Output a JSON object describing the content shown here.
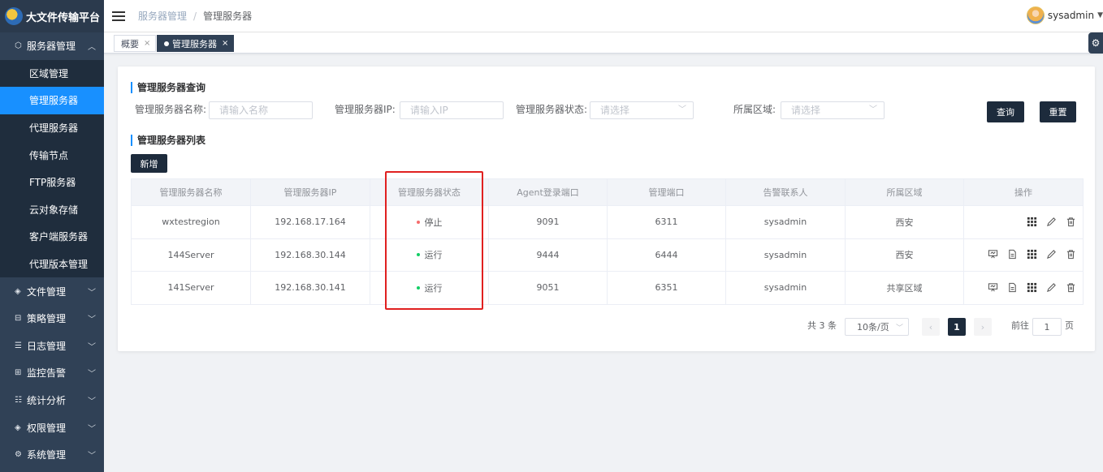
{
  "app": {
    "title": "大文件传输平台"
  },
  "sidebar": {
    "groups": [
      {
        "label": "服务器管理",
        "icon": "cube-icon",
        "expanded": true,
        "items": [
          "区域管理",
          "管理服务器",
          "代理服务器",
          "传输节点",
          "FTP服务器",
          "云对象存储",
          "客户端服务器",
          "代理版本管理"
        ],
        "active": "管理服务器"
      },
      {
        "label": "文件管理",
        "icon": "layers-icon"
      },
      {
        "label": "策略管理",
        "icon": "policy-icon"
      },
      {
        "label": "日志管理",
        "icon": "log-icon"
      },
      {
        "label": "监控告警",
        "icon": "monitor-icon"
      },
      {
        "label": "统计分析",
        "icon": "stats-icon"
      },
      {
        "label": "权限管理",
        "icon": "permission-icon"
      },
      {
        "label": "系统管理",
        "icon": "settings-icon"
      }
    ]
  },
  "header": {
    "breadcrumb": [
      "服务器管理",
      "管理服务器"
    ],
    "username": "sysadmin"
  },
  "tags": [
    {
      "label": "概要",
      "active": false
    },
    {
      "label": "管理服务器",
      "active": true
    }
  ],
  "query": {
    "title": "管理服务器查询",
    "name_label": "管理服务器名称:",
    "name_placeholder": "请输入名称",
    "ip_label": "管理服务器IP:",
    "ip_placeholder": "请输入IP",
    "status_label": "管理服务器状态:",
    "status_placeholder": "请选择",
    "region_label": "所属区域:",
    "region_placeholder": "请选择",
    "search_btn": "查询",
    "reset_btn": "重置"
  },
  "list": {
    "title": "管理服务器列表",
    "add_btn": "新增",
    "columns": [
      "管理服务器名称",
      "管理服务器IP",
      "管理服务器状态",
      "Agent登录端口",
      "管理端口",
      "告警联系人",
      "所属区域",
      "操作"
    ],
    "rows": [
      {
        "name": "wxtestregion",
        "ip": "192.168.17.164",
        "status": "停止",
        "status_color": "#f56c6c",
        "agent_port": "9091",
        "mgmt_port": "6311",
        "contact": "sysadmin",
        "region": "西安",
        "ops": [
          "grid-icon",
          "edit-icon",
          "delete-icon"
        ]
      },
      {
        "name": "144Server",
        "ip": "192.168.30.144",
        "status": "运行",
        "status_color": "#13ce66",
        "agent_port": "9444",
        "mgmt_port": "6444",
        "contact": "sysadmin",
        "region": "西安",
        "ops": [
          "monitor-icon",
          "document-icon",
          "grid-icon",
          "edit-icon",
          "delete-icon"
        ]
      },
      {
        "name": "141Server",
        "ip": "192.168.30.141",
        "status": "运行",
        "status_color": "#13ce66",
        "agent_port": "9051",
        "mgmt_port": "6351",
        "contact": "sysadmin",
        "region": "共享区域",
        "ops": [
          "monitor-icon",
          "document-icon",
          "grid-icon",
          "edit-icon",
          "delete-icon"
        ]
      }
    ]
  },
  "pagination": {
    "total_text": "共 3 条",
    "page_size": "10条/页",
    "current_page": "1",
    "goto_label": "前往",
    "goto_value": "1",
    "page_unit": "页"
  }
}
